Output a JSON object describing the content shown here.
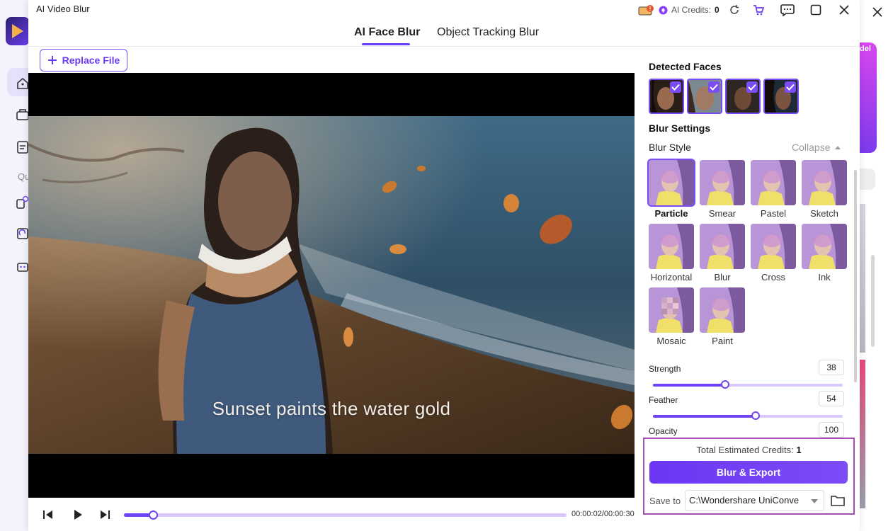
{
  "window": {
    "title": "AI Video Blur"
  },
  "titlebar": {
    "credits_label": "AI Credits:",
    "credits_value": "0",
    "icons": [
      "gift-icon",
      "credit-coin-icon",
      "refresh-icon",
      "cart-icon",
      "feedback-icon",
      "maximize-icon",
      "close-icon"
    ]
  },
  "tabs": [
    {
      "label": "AI Face Blur",
      "active": true
    },
    {
      "label": "Object Tracking Blur",
      "active": false
    }
  ],
  "replace_file": {
    "label": "Replace File"
  },
  "video": {
    "subtitle": "Sunset paints the water gold",
    "time": "00:00:02/00:00:30",
    "progress": 0.065
  },
  "panel": {
    "detected_faces_title": "Detected Faces",
    "faces": [
      {
        "name": "face-1",
        "checked": true
      },
      {
        "name": "face-2",
        "checked": true
      },
      {
        "name": "face-3",
        "checked": true
      },
      {
        "name": "face-4",
        "checked": true
      }
    ],
    "blur_settings_title": "Blur Settings",
    "blur_style_label": "Blur Style",
    "collapse_label": "Collapse",
    "styles": [
      {
        "label": "Particle",
        "selected": true
      },
      {
        "label": "Smear",
        "selected": false
      },
      {
        "label": "Pastel",
        "selected": false
      },
      {
        "label": "Sketch",
        "selected": false
      },
      {
        "label": "Horizontal",
        "selected": false
      },
      {
        "label": "Blur",
        "selected": false
      },
      {
        "label": "Cross",
        "selected": false
      },
      {
        "label": "Ink",
        "selected": false
      },
      {
        "label": "Mosaic",
        "selected": false
      },
      {
        "label": "Paint",
        "selected": false
      }
    ],
    "sliders": [
      {
        "label": "Strength",
        "value": "38",
        "fraction": 0.38
      },
      {
        "label": "Feather",
        "value": "54",
        "fraction": 0.54
      },
      {
        "label": "Opacity",
        "value": "100",
        "fraction": 1.0
      }
    ]
  },
  "export": {
    "credits_label": "Total Estimated Credits:",
    "credits_value": "1",
    "button_label": "Blur & Export",
    "save_to_label": "Save to",
    "save_path": "C:\\Wondershare UniConve"
  },
  "background_app": {
    "sidebar_text": "Qu",
    "promo_text": "del"
  },
  "colors": {
    "accent": "#7044f4",
    "highlight_border": "#a44fb5"
  }
}
